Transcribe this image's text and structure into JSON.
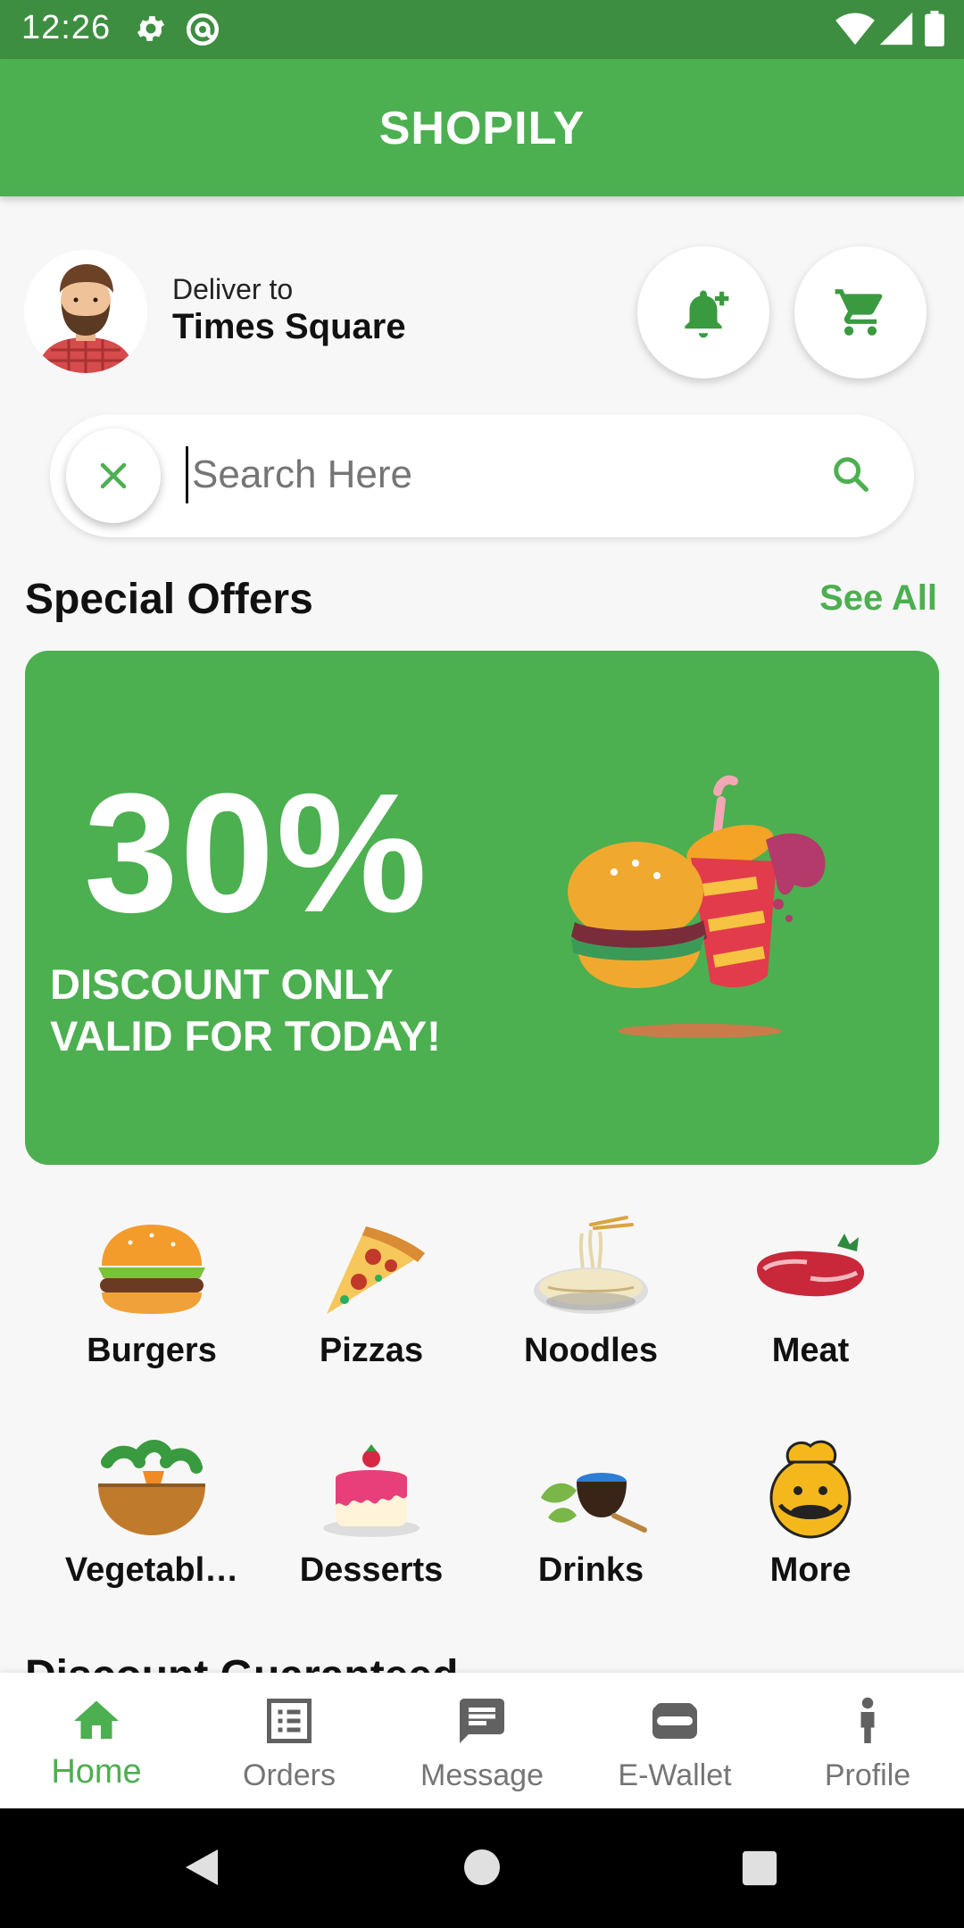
{
  "status_bar": {
    "time": "12:26"
  },
  "app": {
    "title": "SHOPILY"
  },
  "delivery": {
    "label": "Deliver to",
    "location": "Times Square"
  },
  "search": {
    "placeholder": "Search Here"
  },
  "special_offers": {
    "title": "Special Offers",
    "see_all": "See All",
    "promo": {
      "percent": "30%",
      "line1": "DISCOUNT ONLY",
      "line2": "VALID FOR TODAY!"
    }
  },
  "categories": [
    {
      "label": "Burgers",
      "icon": "burger-icon"
    },
    {
      "label": "Pizzas",
      "icon": "pizza-icon"
    },
    {
      "label": "Noodles",
      "icon": "noodles-icon"
    },
    {
      "label": "Meat",
      "icon": "meat-icon"
    },
    {
      "label": "Vegetabl…",
      "icon": "vegetables-icon"
    },
    {
      "label": "Desserts",
      "icon": "dessert-icon"
    },
    {
      "label": "Drinks",
      "icon": "drinks-icon"
    },
    {
      "label": "More",
      "icon": "more-icon"
    }
  ],
  "next_section": {
    "title": "Discount Guaranteed"
  },
  "bottom_nav": [
    {
      "label": "Home",
      "icon": "home-icon",
      "active": true
    },
    {
      "label": "Orders",
      "icon": "orders-icon"
    },
    {
      "label": "Message",
      "icon": "message-icon"
    },
    {
      "label": "E-Wallet",
      "icon": "wallet-icon"
    },
    {
      "label": "Profile",
      "icon": "profile-icon"
    }
  ],
  "colors": {
    "primary": "#4caf50",
    "status_bar": "#3e8e41"
  }
}
